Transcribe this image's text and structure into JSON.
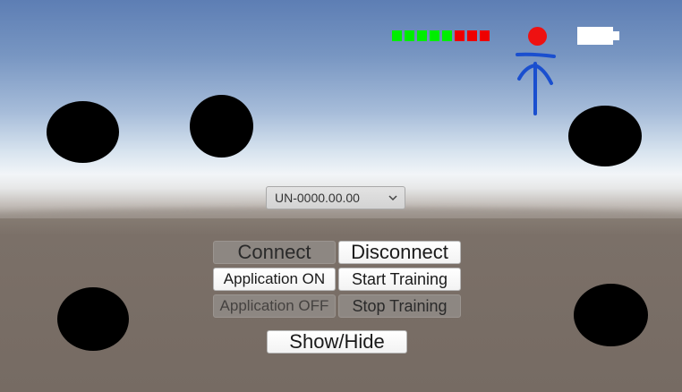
{
  "colors": {
    "signal_on": "#00ee00",
    "signal_off": "#ee0000",
    "status_dot": "#ee1111",
    "annotation_ink": "#1a4fcf"
  },
  "signal": {
    "segments": [
      "on",
      "on",
      "on",
      "on",
      "on",
      "off",
      "off",
      "off"
    ]
  },
  "icons": {
    "status": "status-dot-icon",
    "battery": "battery-icon",
    "annotation": "hand-drawn-arrow-icon",
    "chevron": "chevron-down-icon"
  },
  "device_dropdown": {
    "selected": "UN-0000.00.00"
  },
  "buttons": {
    "connect": "Connect",
    "disconnect": "Disconnect",
    "application_on": "Application ON",
    "start_training": "Start Training",
    "application_off": "Application OFF",
    "stop_training": "Stop Training",
    "show_hide": "Show/Hide"
  }
}
